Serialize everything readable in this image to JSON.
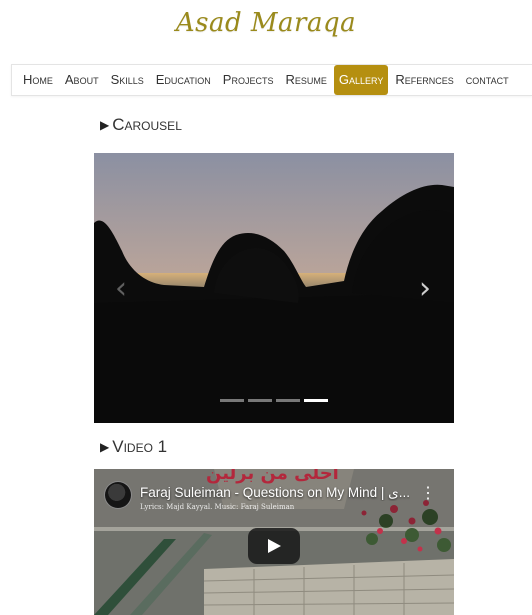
{
  "site": {
    "title": "Asad Maraqa"
  },
  "nav": {
    "items": [
      {
        "label": "Home"
      },
      {
        "label": "About"
      },
      {
        "label": "Skills"
      },
      {
        "label": "Education"
      },
      {
        "label": "Projects"
      },
      {
        "label": "Resume"
      },
      {
        "label": "Gallery"
      },
      {
        "label": "Refernces"
      },
      {
        "label": "contact"
      }
    ],
    "active": "Gallery",
    "active_color": "#b58f10"
  },
  "sections": {
    "carousel": {
      "heading": "Carousel",
      "prev_icon": "chevron-left-icon",
      "next_icon": "chevron-right-icon",
      "slide_count": 4,
      "active_slide": 4
    },
    "video1": {
      "heading": "Video 1",
      "title": "Faraj Suleiman - Questions on My Mind | ی...",
      "subtitle": "Lyrics: Majd Kayyal. Music: Faraj Suleiman",
      "overlay_text": "أحلى من برلين",
      "menu_icon": "more-vertical-icon",
      "play_icon": "play-icon"
    }
  }
}
